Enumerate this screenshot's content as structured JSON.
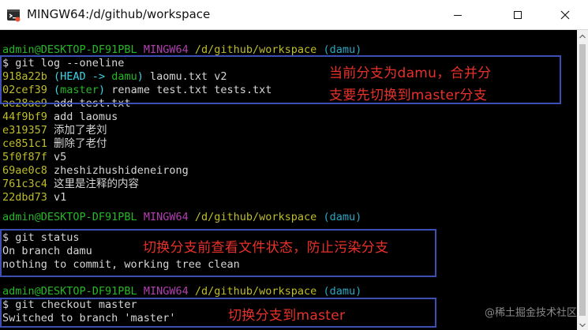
{
  "window": {
    "title": "MINGW64:/d/github/workspace"
  },
  "icons": {
    "app": "git-bash-icon",
    "minimize": "minimize-icon",
    "maximize": "maximize-icon",
    "close": "close-icon"
  },
  "colors": {
    "user_host": "#26b726",
    "mingw": "#b23fb2",
    "path": "#bfbd2a",
    "branch": "#2aa7c4",
    "annotation_text": "#e8312a",
    "annotation_box": "#3c4fb4"
  },
  "terminal": {
    "prompt1": {
      "user_host": "admin@DESKTOP-DF91PBL",
      "env": "MINGW64",
      "path": "/d/github/workspace",
      "branch": "(damu)"
    },
    "cmd1": "$ git log --oneline",
    "log": [
      {
        "hash": "918a22b",
        "ref_open": " (",
        "head": "HEAD -> ",
        "ref_branch": "damu",
        "ref_close": ")",
        "msg": " laomu.txt v2"
      },
      {
        "hash": "02cef39",
        "ref_open": " (",
        "head": "",
        "ref_branch": "master",
        "ref_close": ")",
        "msg": " rename test.txt tests.txt"
      },
      {
        "hash": "ae28ae9",
        "msg": " add test.txt"
      },
      {
        "hash": "44f9bf9",
        "msg": " add laomus"
      },
      {
        "hash": "e319357",
        "msg": " 添加了老刘"
      },
      {
        "hash": "ce851c1",
        "msg": " 删除了老付"
      },
      {
        "hash": "5f0f87f",
        "msg": " v5"
      },
      {
        "hash": "69ae0c8",
        "msg": " zheshizhushideneirong"
      },
      {
        "hash": "761c3c4",
        "msg": " 这里是注释的内容"
      },
      {
        "hash": "22dbd73",
        "msg": " v1"
      }
    ],
    "prompt2": {
      "user_host": "admin@DESKTOP-DF91PBL",
      "env": "MINGW64",
      "path": "/d/github/workspace",
      "branch": "(damu)"
    },
    "cmd2": "$ git status",
    "status_line1": "On branch damu",
    "status_line2": "nothing to commit, working tree clean",
    "prompt3": {
      "user_host": "admin@DESKTOP-DF91PBL",
      "env": "MINGW64",
      "path": "/d/github/workspace",
      "branch": "(damu)"
    },
    "cmd3": "$ git checkout master",
    "checkout_output": "Switched to branch 'master'"
  },
  "annotations": {
    "note1_line1": "当前分支为damu，合并分",
    "note1_line2": "支要先切换到master分支",
    "note2": "切换分支前查看文件状态，防止污染分支",
    "note3": "切换分支到master"
  },
  "watermark": "@稀土掘金技术社区"
}
